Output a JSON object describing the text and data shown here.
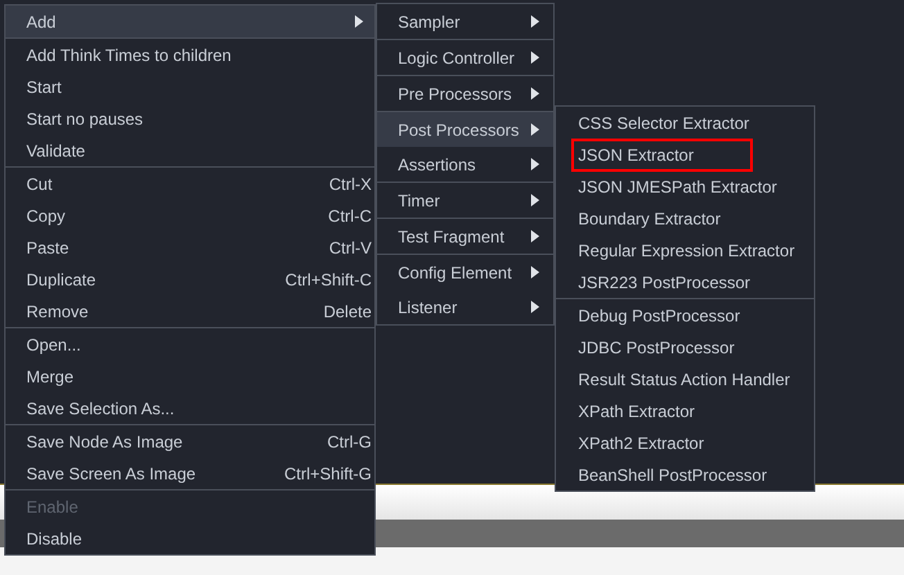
{
  "context_menu": {
    "sections": [
      {
        "items": [
          {
            "label": "Add",
            "submenu": true,
            "selected": true,
            "disabled": false
          }
        ]
      },
      {
        "items": [
          {
            "label": "Add Think Times to children",
            "submenu": false,
            "selected": false,
            "disabled": false
          },
          {
            "label": "Start",
            "submenu": false,
            "selected": false,
            "disabled": false
          },
          {
            "label": "Start no pauses",
            "submenu": false,
            "selected": false,
            "disabled": false
          },
          {
            "label": "Validate",
            "submenu": false,
            "selected": false,
            "disabled": false
          }
        ]
      },
      {
        "items": [
          {
            "label": "Cut",
            "shortcut": "Ctrl-X",
            "submenu": false,
            "selected": false,
            "disabled": false
          },
          {
            "label": "Copy",
            "shortcut": "Ctrl-C",
            "submenu": false,
            "selected": false,
            "disabled": false
          },
          {
            "label": "Paste",
            "shortcut": "Ctrl-V",
            "submenu": false,
            "selected": false,
            "disabled": false
          },
          {
            "label": "Duplicate",
            "shortcut": "Ctrl+Shift-C",
            "submenu": false,
            "selected": false,
            "disabled": false
          },
          {
            "label": "Remove",
            "shortcut": "Delete",
            "submenu": false,
            "selected": false,
            "disabled": false
          }
        ]
      },
      {
        "items": [
          {
            "label": "Open...",
            "submenu": false,
            "selected": false,
            "disabled": false
          },
          {
            "label": "Merge",
            "submenu": false,
            "selected": false,
            "disabled": false
          },
          {
            "label": "Save Selection As...",
            "submenu": false,
            "selected": false,
            "disabled": false
          }
        ]
      },
      {
        "items": [
          {
            "label": "Save Node As Image",
            "shortcut": "Ctrl-G",
            "submenu": false,
            "selected": false,
            "disabled": false
          },
          {
            "label": "Save Screen As Image",
            "shortcut": "Ctrl+Shift-G",
            "submenu": false,
            "selected": false,
            "disabled": false
          }
        ]
      },
      {
        "items": [
          {
            "label": "Enable",
            "submenu": false,
            "selected": false,
            "disabled": true
          },
          {
            "label": "Disable",
            "submenu": false,
            "selected": false,
            "disabled": false
          }
        ]
      }
    ]
  },
  "add_submenu": {
    "sections": [
      {
        "items": [
          {
            "label": "Sampler",
            "submenu": true,
            "selected": false
          }
        ]
      },
      {
        "items": [
          {
            "label": "Logic Controller",
            "submenu": true,
            "selected": false
          }
        ]
      },
      {
        "items": [
          {
            "label": "Pre Processors",
            "submenu": true,
            "selected": false
          }
        ]
      },
      {
        "items": [
          {
            "label": "Post Processors",
            "submenu": true,
            "selected": true
          },
          {
            "label": "Assertions",
            "submenu": true,
            "selected": false
          }
        ]
      },
      {
        "items": [
          {
            "label": "Timer",
            "submenu": true,
            "selected": false
          }
        ]
      },
      {
        "items": [
          {
            "label": "Test Fragment",
            "submenu": true,
            "selected": false
          }
        ]
      },
      {
        "items": [
          {
            "label": "Config Element",
            "submenu": true,
            "selected": false
          },
          {
            "label": "Listener",
            "submenu": true,
            "selected": false
          }
        ]
      }
    ]
  },
  "post_processors_submenu": {
    "sections": [
      {
        "items": [
          {
            "label": "CSS Selector Extractor",
            "highlighted": false
          },
          {
            "label": "JSON Extractor",
            "highlighted": true
          },
          {
            "label": "JSON JMESPath Extractor",
            "highlighted": false
          },
          {
            "label": "Boundary Extractor",
            "highlighted": false
          },
          {
            "label": "Regular Expression Extractor",
            "highlighted": false
          },
          {
            "label": "JSR223 PostProcessor",
            "highlighted": false
          }
        ]
      },
      {
        "items": [
          {
            "label": "Debug PostProcessor",
            "highlighted": false
          },
          {
            "label": "JDBC PostProcessor",
            "highlighted": false
          },
          {
            "label": "Result Status Action Handler",
            "highlighted": false
          },
          {
            "label": "XPath Extractor",
            "highlighted": false
          },
          {
            "label": "XPath2 Extractor",
            "highlighted": false
          },
          {
            "label": "BeanShell PostProcessor",
            "highlighted": false
          }
        ]
      }
    ]
  }
}
